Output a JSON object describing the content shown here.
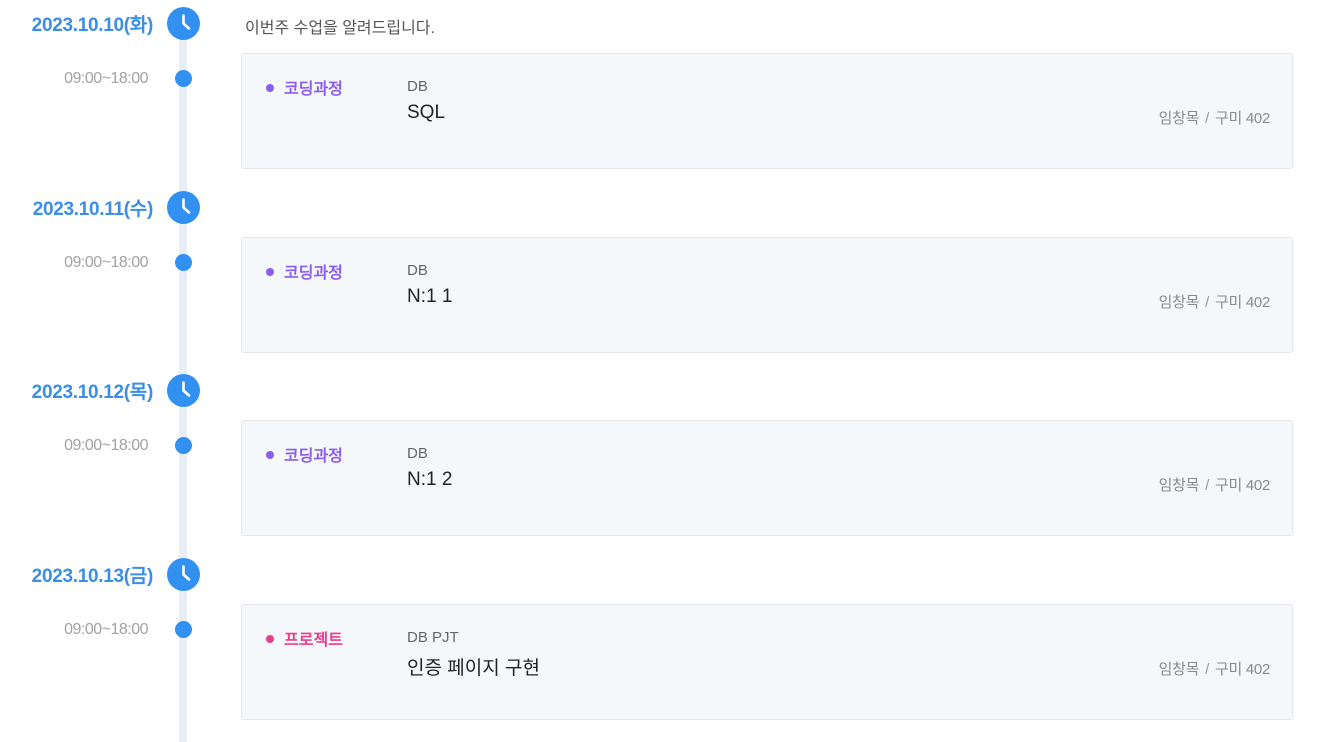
{
  "intro": "이번주 수업을 알려드립니다.",
  "colors": {
    "date": "#3a8ee6",
    "timeline_dot": "#3291f0",
    "coding_course": "#8c5cf0",
    "project": "#ea3c8c"
  },
  "icons": {
    "clock": "clock-icon"
  },
  "days": [
    {
      "date": "2023.10.10(화)",
      "time": "09:00~18:00",
      "category": "코딩과정",
      "category_color": "#8c5cf0",
      "subject": "DB",
      "topic": "SQL",
      "instructor": "임창목",
      "separator": "/",
      "room": "구미 402"
    },
    {
      "date": "2023.10.11(수)",
      "time": "09:00~18:00",
      "category": "코딩과정",
      "category_color": "#8c5cf0",
      "subject": "DB",
      "topic": "N:1 1",
      "instructor": "임창목",
      "separator": "/",
      "room": "구미 402"
    },
    {
      "date": "2023.10.12(목)",
      "time": "09:00~18:00",
      "category": "코딩과정",
      "category_color": "#8c5cf0",
      "subject": "DB",
      "topic": "N:1 2",
      "instructor": "임창목",
      "separator": "/",
      "room": "구미 402"
    },
    {
      "date": "2023.10.13(금)",
      "time": "09:00~18:00",
      "category": "프로젝트",
      "category_color": "#ea3c8c",
      "subject": "DB PJT",
      "topic": "인증 페이지 구현",
      "instructor": "임창목",
      "separator": "/",
      "room": "구미 402"
    }
  ]
}
